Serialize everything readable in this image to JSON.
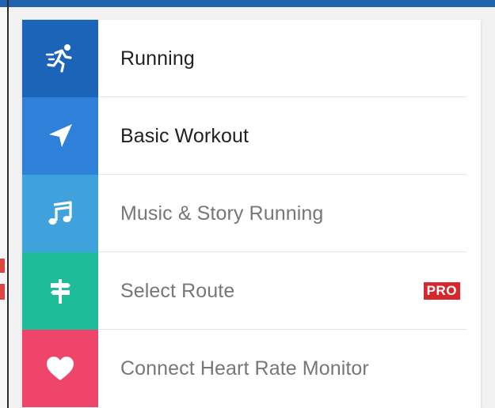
{
  "colors": {
    "top_bar": "#1f62ad",
    "running_tile": "#1b64b7",
    "basic_workout_tile": "#2f80d9",
    "music_tile": "#3fa2dd",
    "route_tile": "#1fbc9a",
    "heart_tile": "#f0456a",
    "pro_badge": "#d7262c"
  },
  "menu": {
    "items": [
      {
        "label": "Running",
        "icon": "runner-icon",
        "enabled": true
      },
      {
        "label": "Basic Workout",
        "icon": "navigation-arrow-icon",
        "enabled": true
      },
      {
        "label": "Music & Story Running",
        "icon": "music-note-icon",
        "enabled": false
      },
      {
        "label": "Select Route",
        "icon": "signpost-icon",
        "enabled": false,
        "badge": "PRO"
      },
      {
        "label": "Connect Heart Rate Monitor",
        "icon": "heart-icon",
        "enabled": false
      }
    ]
  }
}
